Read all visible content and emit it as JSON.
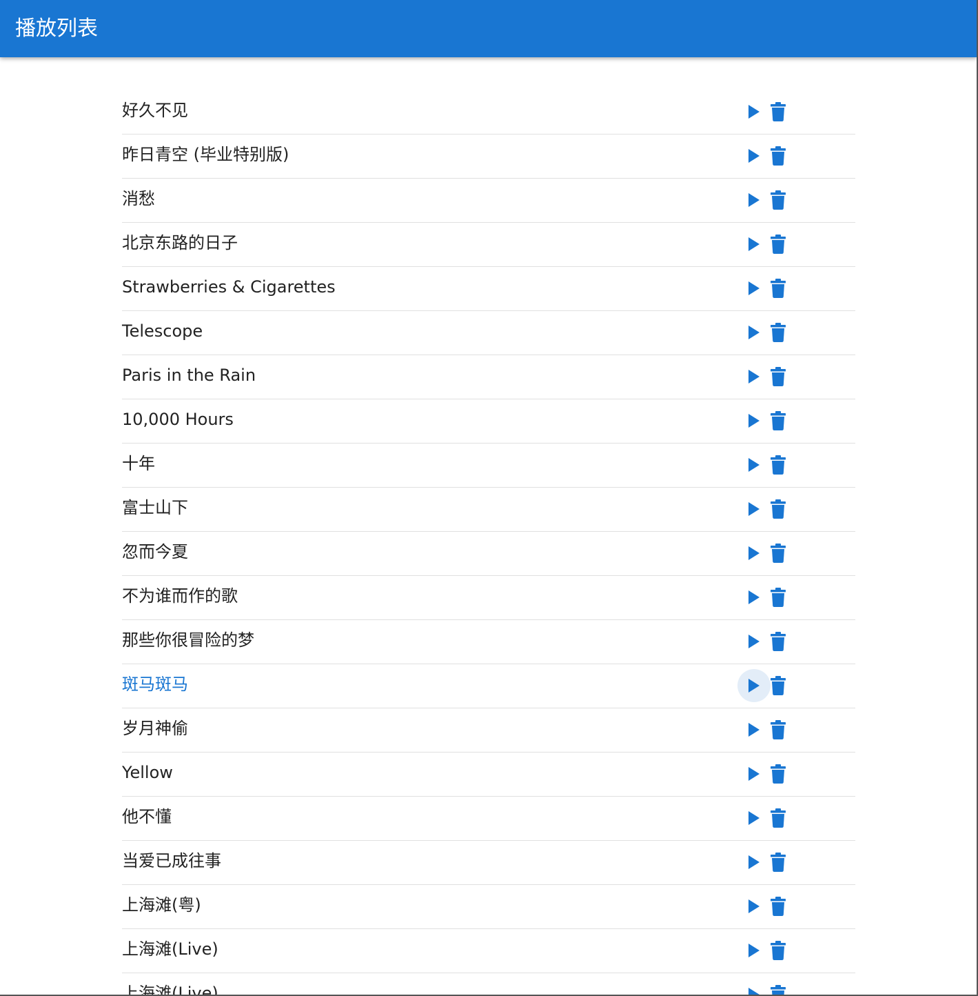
{
  "appbar": {
    "title": "播放列表",
    "color": "#1976d2"
  },
  "accent_color": "#1976d2",
  "playlist": {
    "active_index": 13,
    "items": [
      {
        "title": "好久不见"
      },
      {
        "title": "昨日青空 (毕业特别版)"
      },
      {
        "title": "消愁"
      },
      {
        "title": "北京东路的日子"
      },
      {
        "title": "Strawberries & Cigarettes"
      },
      {
        "title": "Telescope"
      },
      {
        "title": "Paris in the Rain"
      },
      {
        "title": "10,000 Hours"
      },
      {
        "title": "十年"
      },
      {
        "title": "富士山下"
      },
      {
        "title": "忽而今夏"
      },
      {
        "title": "不为谁而作的歌"
      },
      {
        "title": "那些你很冒险的梦"
      },
      {
        "title": "斑马斑马"
      },
      {
        "title": "岁月神偷"
      },
      {
        "title": "Yellow"
      },
      {
        "title": "他不懂"
      },
      {
        "title": "当爱已成往事"
      },
      {
        "title": "上海滩(粤)"
      },
      {
        "title": "上海滩(Live)"
      },
      {
        "title": "上海滩(Live)"
      }
    ],
    "play_icon": "play-arrow-icon",
    "delete_icon": "trash-can-icon"
  }
}
